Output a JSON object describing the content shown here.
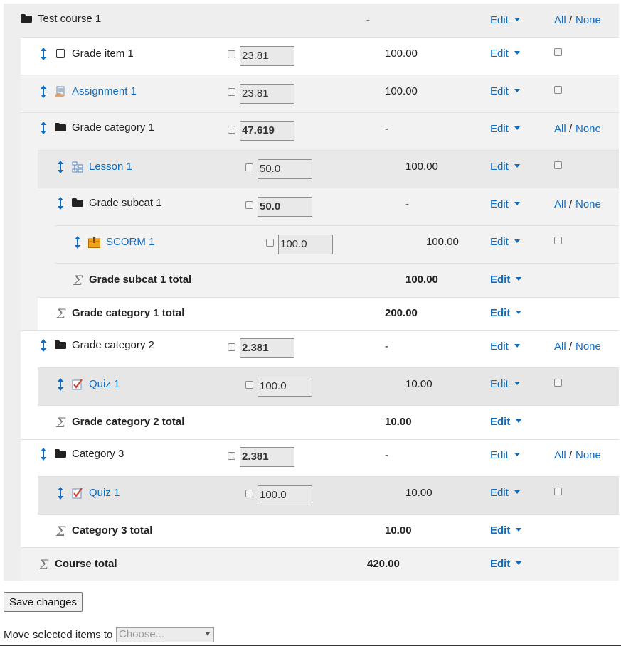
{
  "course": {
    "name": "Test course 1",
    "max": "-",
    "edit": "Edit",
    "all": "All",
    "sep": "/",
    "none": "None"
  },
  "rows": {
    "grade_item_1": {
      "name": "Grade item 1",
      "weight": "23.81",
      "max": "100.00",
      "edit": "Edit"
    },
    "assignment_1": {
      "name": "Assignment 1",
      "weight": "23.81",
      "max": "100.00",
      "edit": "Edit"
    },
    "grade_category_1": {
      "name": "Grade category 1",
      "weight": "47.619",
      "max": "-",
      "edit": "Edit",
      "all": "All",
      "sep": "/",
      "none": "None"
    },
    "lesson_1": {
      "name": "Lesson 1",
      "weight": "50.0",
      "max": "100.00",
      "edit": "Edit"
    },
    "grade_subcat_1": {
      "name": "Grade subcat 1",
      "weight": "50.0",
      "max": "-",
      "edit": "Edit",
      "all": "All",
      "sep": "/",
      "none": "None"
    },
    "scorm_1": {
      "name": "SCORM 1",
      "weight": "100.0",
      "max": "100.00",
      "edit": "Edit"
    },
    "grade_subcat_1_total": {
      "name": "Grade subcat 1 total",
      "max": "100.00",
      "edit": "Edit"
    },
    "grade_category_1_total": {
      "name": "Grade category 1 total",
      "max": "200.00",
      "edit": "Edit"
    },
    "grade_category_2": {
      "name": "Grade category 2",
      "weight": "2.381",
      "max": "-",
      "edit": "Edit",
      "all": "All",
      "sep": "/",
      "none": "None"
    },
    "quiz_1_a": {
      "name": "Quiz 1",
      "weight": "100.0",
      "max": "10.00",
      "edit": "Edit"
    },
    "grade_category_2_total": {
      "name": "Grade category 2 total",
      "max": "10.00",
      "edit": "Edit"
    },
    "category_3": {
      "name": "Category 3",
      "weight": "2.381",
      "max": "-",
      "edit": "Edit",
      "all": "All",
      "sep": "/",
      "none": "None"
    },
    "quiz_1_b": {
      "name": "Quiz 1",
      "weight": "100.0",
      "max": "10.00",
      "edit": "Edit"
    },
    "category_3_total": {
      "name": "Category 3 total",
      "max": "10.00",
      "edit": "Edit"
    },
    "course_total": {
      "name": "Course total",
      "max": "420.00",
      "edit": "Edit"
    }
  },
  "footer": {
    "save_label": "Save changes",
    "move_label": "Move selected items to",
    "move_select": "Choose..."
  },
  "colors": {
    "link": "#0f6cbf",
    "band": "#eeeeee",
    "input_bg": "#e9e9e9"
  }
}
